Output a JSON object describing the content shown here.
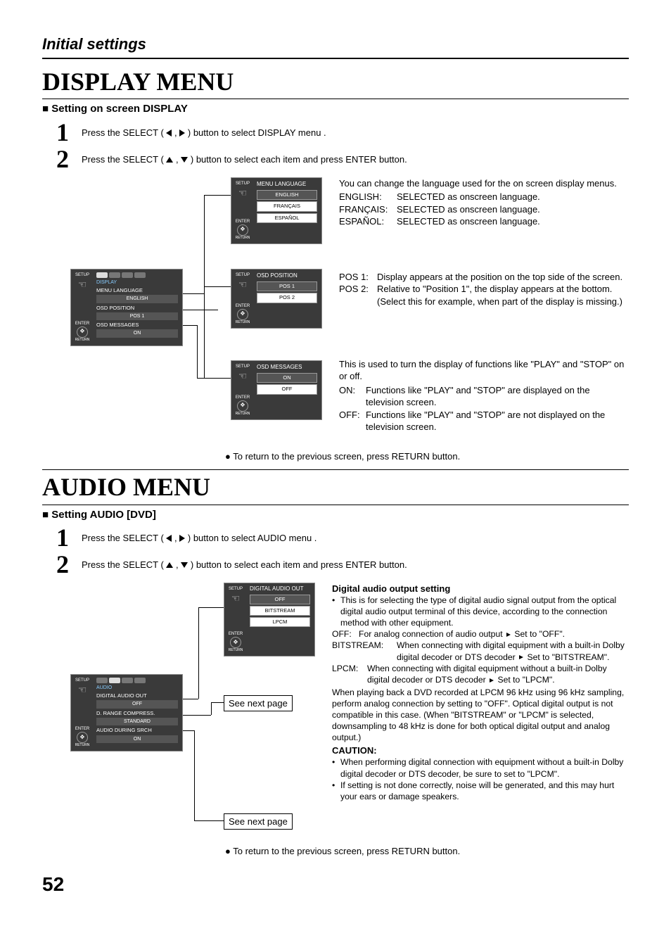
{
  "breadcrumb": "Initial settings",
  "display": {
    "title": "DISPLAY MENU",
    "subheading": "Setting on screen DISPLAY",
    "step1_a": "Press the SELECT ( ",
    "step1_b": " , ",
    "step1_c": " ) button to select DISPLAY menu .",
    "step2_a": "Press the SELECT ( ",
    "step2_b": " , ",
    "step2_c": " ) button to select each item and press ENTER button.",
    "main_panel": {
      "section_label": "DISPLAY",
      "row1_label": "MENU LANGUAGE",
      "row1_val": "ENGLISH",
      "row2_label": "OSD POSITION",
      "row2_val": "POS  1",
      "row3_label": "OSD MESSAGES",
      "row3_val": "ON"
    },
    "lang_panel": {
      "header": "MENU LANGUAGE",
      "opt1": "ENGLISH",
      "opt2": "FRANÇAIS",
      "opt3": "ESPAÑOL"
    },
    "pos_panel": {
      "header": "OSD POSITION",
      "opt1": "POS 1",
      "opt2": "POS 2"
    },
    "msg_panel": {
      "header": "OSD MESSAGES",
      "opt1": "ON",
      "opt2": "OFF"
    },
    "side_labels": {
      "setup": "SETUP",
      "enter": "ENTER",
      "return": "RETURN"
    },
    "lang_desc_intro": "You can change the language used for the on screen display menus.",
    "lang_rows": [
      {
        "k": "ENGLISH:",
        "v": "SELECTED as onscreen language."
      },
      {
        "k": "FRANÇAIS:",
        "v": "SELECTED as onscreen language."
      },
      {
        "k": "ESPAÑOL:",
        "v": "SELECTED as onscreen language."
      }
    ],
    "pos_rows": [
      {
        "k": "POS 1:",
        "v": "Display appears at the position on the top side of the screen."
      },
      {
        "k": "POS 2:",
        "v": "Relative to \"Position 1\", the display appears at the bottom."
      }
    ],
    "pos_extra": "(Select this for example, when part of the display is missing.)",
    "msg_intro": "This is used to turn the display of functions like \"PLAY\" and \"STOP\" on or off.",
    "msg_rows": [
      {
        "k": "ON:",
        "v": "Functions like \"PLAY\" and \"STOP\" are displayed on the television screen."
      },
      {
        "k": "OFF:",
        "v": "Functions like \"PLAY\" and \"STOP\" are not displayed on the television screen."
      }
    ],
    "return_note": "To return to the previous screen, press RETURN button."
  },
  "audio": {
    "title": "AUDIO MENU",
    "subheading": "Setting AUDIO [DVD]",
    "step1_a": "Press the SELECT ( ",
    "step1_b": " , ",
    "step1_c": " ) button to select AUDIO menu .",
    "step2_a": "Press the SELECT ( ",
    "step2_b": " , ",
    "step2_c": " ) button to select each item and press ENTER button.",
    "main_panel": {
      "section_label": "AUDIO",
      "row1_label": "DIGITAL AUDIO OUT",
      "row1_val": "OFF",
      "row2_label": "D. RANGE COMPRESS.",
      "row2_val": "STANDARD",
      "row3_label": "AUDIO DURING SRCH",
      "row3_val": "ON"
    },
    "digital_panel": {
      "header": "DIGITAL AUDIO OUT",
      "opt1": "OFF",
      "opt2": "BITSTREAM",
      "opt3": "LPCM"
    },
    "see_next": "See next page",
    "heading": "Digital audio output setting",
    "bullet1": "This is for selecting the type of digital audio signal output from the optical digital audio output terminal of this device, according to the connection method with other equipment.",
    "off_label": "OFF:",
    "off_text_a": "For analog connection of audio output ",
    "off_text_b": " Set to \"OFF\".",
    "bits_label": "BITSTREAM:",
    "bits_text_a": "When connecting with digital equipment with a built-in Dolby digital decoder or DTS decoder ",
    "bits_text_b": " Set to \"BITSTREAM\".",
    "lpcm_label": "LPCM:",
    "lpcm_text_a": "When connecting with digital equipment without a built-in Dolby digital decoder or DTS decoder ",
    "lpcm_text_b": " Set to \"LPCM\".",
    "extra": "When playing back a DVD recorded at LPCM 96 kHz using 96 kHz sampling, perform analog connection by setting to \"OFF\". Optical digital output is not compatible in this case. (When \"BITSTREAM\" or \"LPCM\" is selected, downsampling to 48 kHz is done for both optical digital output and analog output.)",
    "caution": "CAUTION:",
    "caution1": "When performing digital connection with equipment without a built-in Dolby digital decoder or DTS decoder, be sure to set to \"LPCM\".",
    "caution2": "If setting is not done correctly, noise will be generated, and this may hurt your ears or damage speakers.",
    "return_note": "To return to the previous screen, press RETURN button."
  },
  "page_number": "52"
}
